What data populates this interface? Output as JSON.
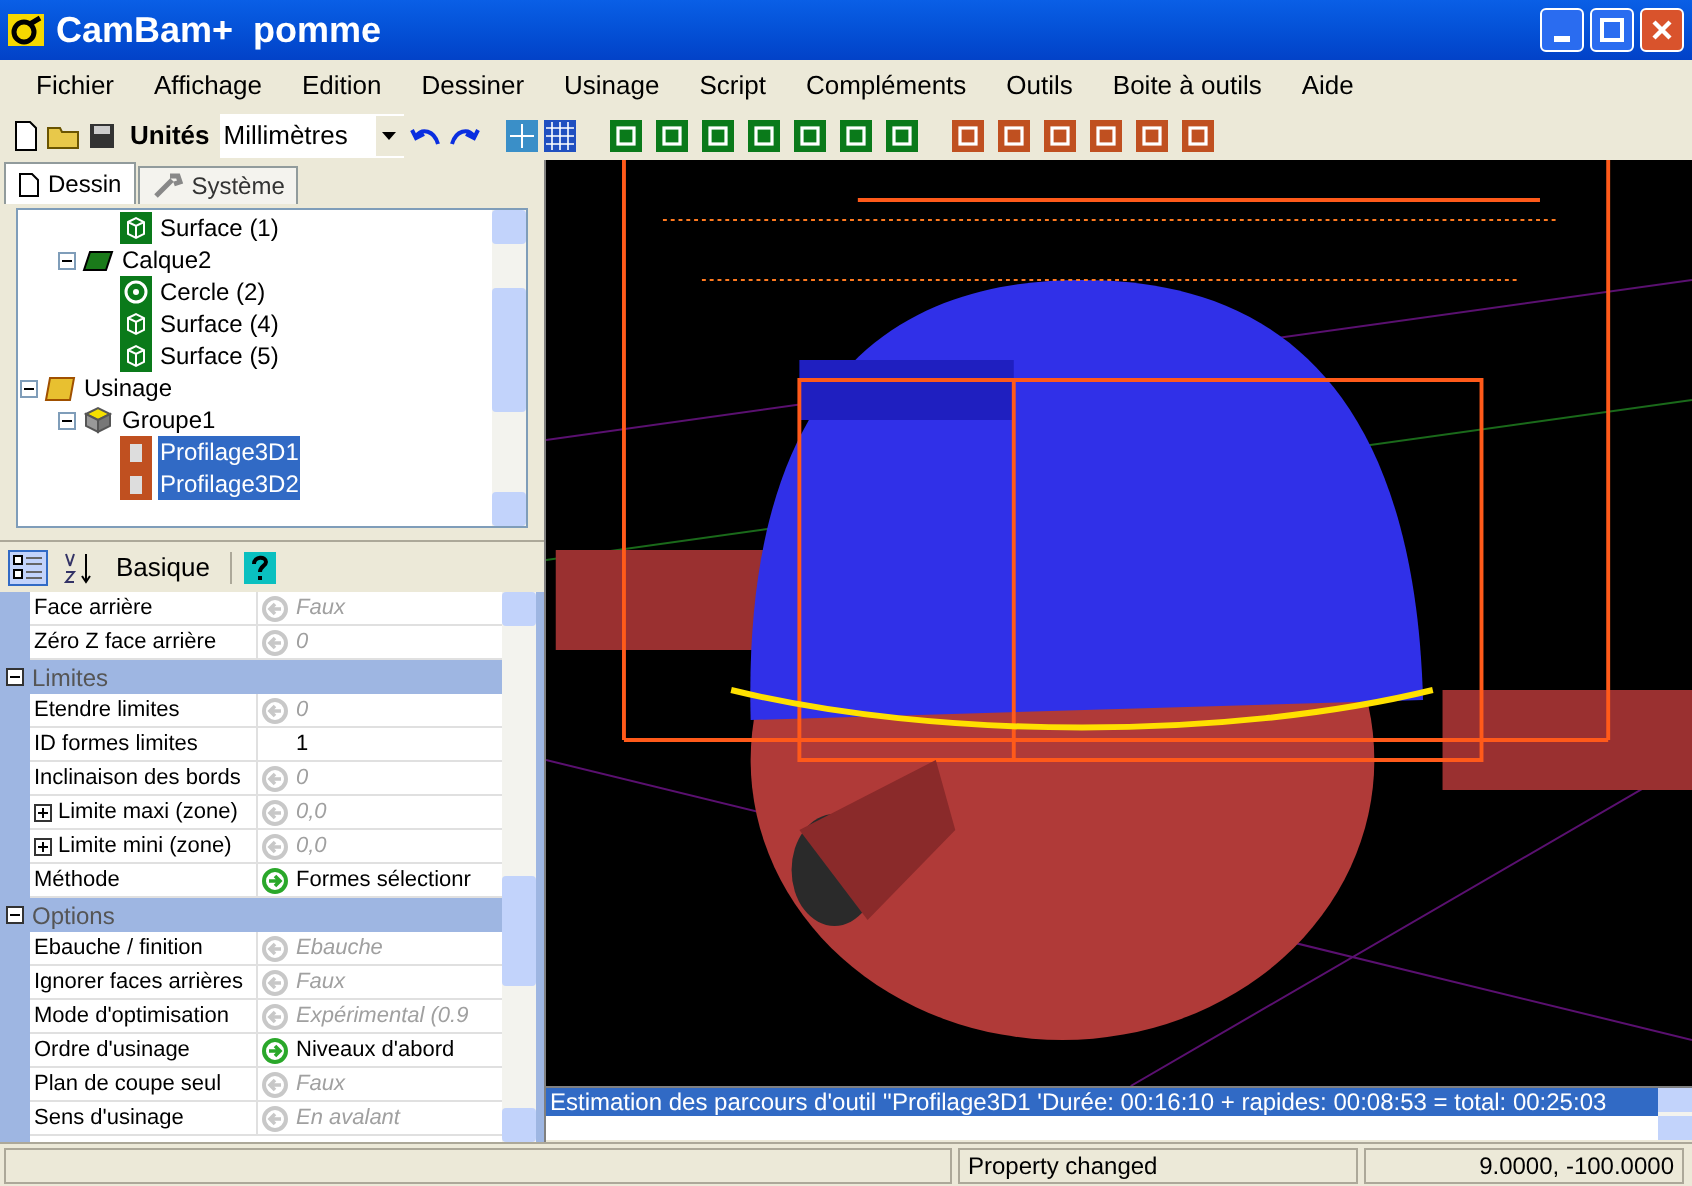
{
  "window": {
    "title": "CamBam+  pomme"
  },
  "menu": [
    "Fichier",
    "Affichage",
    "Edition",
    "Dessiner",
    "Usinage",
    "Script",
    "Compléments",
    "Outils",
    "Boite à outils",
    "Aide"
  ],
  "toolbar": {
    "units_label": "Unités",
    "units_value": "Millimètres"
  },
  "tabs": [
    {
      "label": "Dessin",
      "selected": true
    },
    {
      "label": "Système",
      "selected": false
    }
  ],
  "tree": [
    {
      "children": [
        {
          "children": [
            {
              "label": "Surface (1)",
              "kind": "surface",
              "selected": false
            }
          ]
        },
        {
          "label": "Calque2",
          "kind": "layer",
          "expanded": true,
          "selected": false,
          "children": [
            {
              "label": "Cercle (2)",
              "kind": "circle",
              "selected": false
            },
            {
              "label": "Surface (4)",
              "kind": "surface",
              "selected": false
            },
            {
              "label": "Surface (5)",
              "kind": "surface",
              "selected": false
            }
          ]
        }
      ]
    },
    {
      "label": "Usinage",
      "kind": "machining",
      "expanded": true,
      "selected": false,
      "children": [
        {
          "label": "Groupe1",
          "kind": "group",
          "expanded": true,
          "selected": false,
          "children": [
            {
              "label": "Profilage3D1",
              "kind": "profile",
              "selected": true
            },
            {
              "label": "Profilage3D2",
              "kind": "profile",
              "selected": true
            }
          ]
        }
      ]
    }
  ],
  "properties_toolbar": {
    "mode": "Basique"
  },
  "properties": [
    {
      "kind": "property",
      "name": "Face arrière",
      "value": "Faux",
      "default": true,
      "linked": false
    },
    {
      "kind": "property",
      "name": "Zéro Z face arrière",
      "value": "0",
      "default": true,
      "linked": false
    },
    {
      "kind": "category",
      "name": "Limites",
      "expanded": true
    },
    {
      "kind": "property",
      "name": "Etendre limites",
      "value": "0",
      "default": true,
      "linked": false
    },
    {
      "kind": "property",
      "name": "ID formes limites",
      "value": "1",
      "default": false,
      "linked": false
    },
    {
      "kind": "property",
      "name": "Inclinaison des bords",
      "value": "0",
      "default": true,
      "linked": false
    },
    {
      "kind": "property",
      "name": "Limite maxi (zone)",
      "value": "0,0",
      "default": true,
      "linked": false,
      "expandable": true
    },
    {
      "kind": "property",
      "name": "Limite mini (zone)",
      "value": "0,0",
      "default": true,
      "linked": false,
      "expandable": true
    },
    {
      "kind": "property",
      "name": "Méthode",
      "value": "Formes sélectionr",
      "default": false,
      "linked": true
    },
    {
      "kind": "category",
      "name": "Options",
      "expanded": true
    },
    {
      "kind": "property",
      "name": "Ebauche / finition",
      "value": "Ebauche",
      "default": true,
      "linked": false
    },
    {
      "kind": "property",
      "name": "Ignorer faces arrières",
      "value": "Faux",
      "default": true,
      "linked": false
    },
    {
      "kind": "property",
      "name": "Mode d'optimisation",
      "value": "Expérimental (0.9",
      "default": true,
      "linked": false
    },
    {
      "kind": "property",
      "name": "Ordre d'usinage",
      "value": "Niveaux d'abord",
      "default": false,
      "linked": true
    },
    {
      "kind": "property",
      "name": "Plan de coupe seul",
      "value": "Faux",
      "default": true,
      "linked": false
    },
    {
      "kind": "property",
      "name": "Sens d'usinage",
      "value": "En avalant",
      "default": true,
      "linked": false
    }
  ],
  "log": [
    {
      "text": "Estimation des parcours d'outil ''Profilage3D1 'Durée: 00:16:10 + rapides: 00:08:53 = total: 00:25:03",
      "selected": true
    }
  ],
  "status_bar": {
    "message": "Property changed",
    "coordinates": "9.0000, -100.0000"
  }
}
